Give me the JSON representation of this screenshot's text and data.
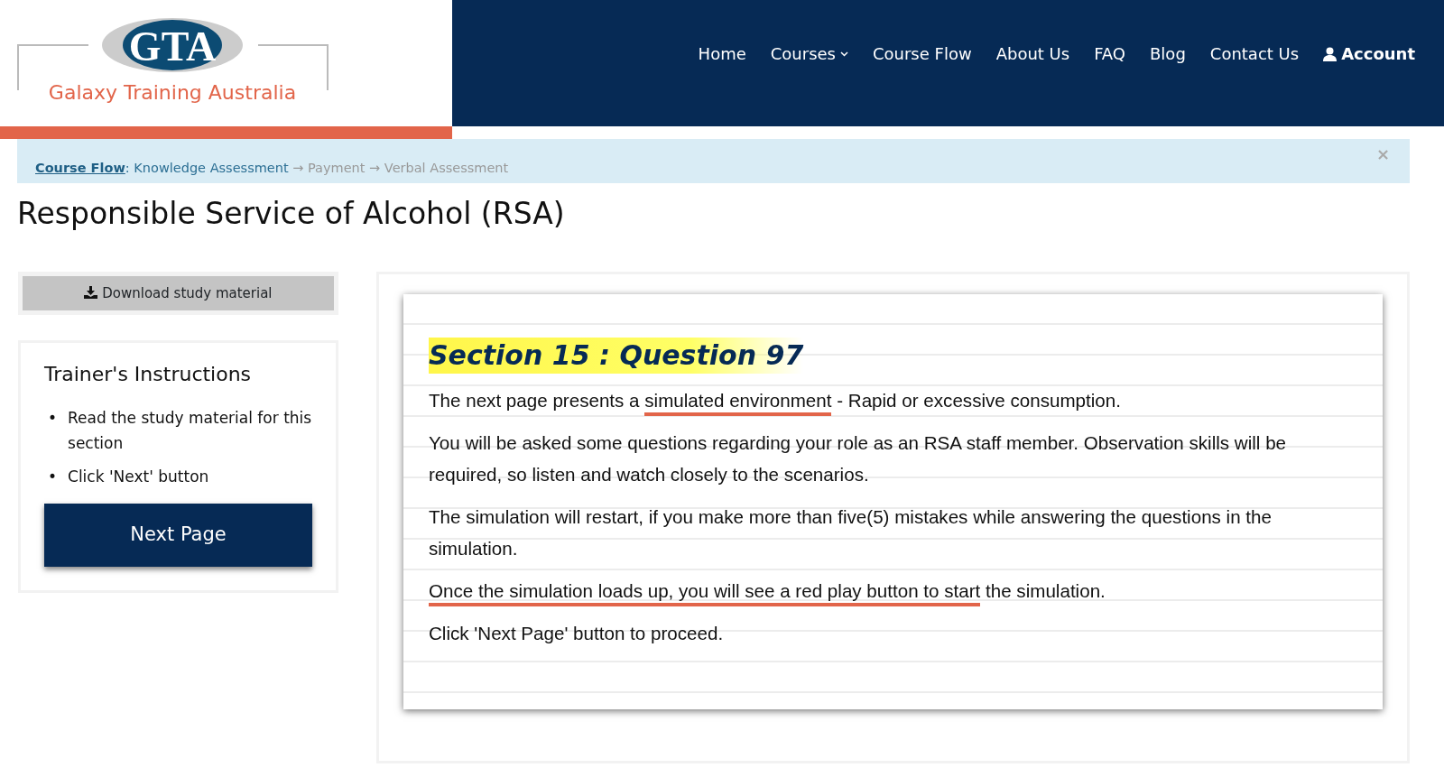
{
  "brand": {
    "monogram": "GTA",
    "name": "Galaxy Training Australia"
  },
  "nav": [
    {
      "label": "Home",
      "kind": "link"
    },
    {
      "label": "Courses",
      "kind": "dropdown"
    },
    {
      "label": "Course Flow",
      "kind": "link"
    },
    {
      "label": "About Us",
      "kind": "link"
    },
    {
      "label": "FAQ",
      "kind": "link"
    },
    {
      "label": "Blog",
      "kind": "link"
    },
    {
      "label": "Contact Us",
      "kind": "link"
    },
    {
      "label": "Account",
      "kind": "account"
    }
  ],
  "breadcrumb": {
    "link": "Course Flow",
    "colon": ":",
    "separator": "→",
    "close": "×",
    "steps": [
      {
        "label": "Knowledge Assessment",
        "current": true
      },
      {
        "label": "Payment",
        "current": false
      },
      {
        "label": "Verbal Assessment",
        "current": false
      }
    ]
  },
  "page_title": "Responsible Service of Alcohol (RSA)",
  "download_button": "Download study material",
  "instructions": {
    "title": "Trainer's Instructions",
    "bullet": "•",
    "items": [
      "Read the study material for this section",
      "Click 'Next' button"
    ],
    "button": "Next Page"
  },
  "document": {
    "heading": "Section 15 : Question 97",
    "paragraphs": [
      [
        {
          "text": "The next page presents a ",
          "underline": false
        },
        {
          "text": "simulated environment",
          "underline": true
        },
        {
          "text": " - Rapid or excessive consumption.",
          "underline": false
        }
      ],
      [
        {
          "text": "You will be asked some questions regarding your role as an RSA staff member. Observation skills will be required, so listen and watch closely to the scenarios.",
          "underline": false
        }
      ],
      [
        {
          "text": "The simulation will restart, if you make more than five(5) mistakes while answering the questions in the simulation.",
          "underline": false
        }
      ],
      [
        {
          "text": "Once the simulation loads up, you will see a red play button to start",
          "underline": true
        },
        {
          "text": " the simulation.",
          "underline": false
        }
      ],
      [
        {
          "text": "Click 'Next Page' button to proceed.",
          "underline": false
        }
      ]
    ]
  }
}
